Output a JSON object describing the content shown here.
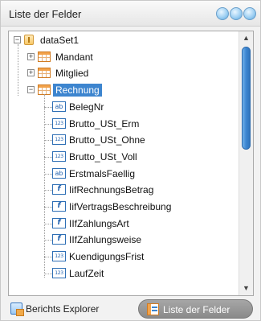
{
  "window": {
    "title": "Liste der Felder"
  },
  "tree": {
    "root": {
      "label": "dataSet1",
      "icon": "database-icon",
      "expander": "−"
    },
    "tables": [
      {
        "label": "Mandant",
        "icon": "table-icon",
        "expander": "+"
      },
      {
        "label": "Mitglied",
        "icon": "table-icon",
        "expander": "+"
      },
      {
        "label": "Rechnung",
        "icon": "table-icon",
        "expander": "−",
        "selected": true
      }
    ],
    "fields": [
      {
        "label": "BelegNr",
        "type": "ab"
      },
      {
        "label": "Brutto_USt_Erm",
        "type": "123"
      },
      {
        "label": "Brutto_USt_Ohne",
        "type": "123"
      },
      {
        "label": "Brutto_USt_Voll",
        "type": "123"
      },
      {
        "label": "ErstmalsFaellig",
        "type": "ab"
      },
      {
        "label": "IifRechnungsBetrag",
        "type": "f"
      },
      {
        "label": "IifVertragsBeschreibung",
        "type": "f"
      },
      {
        "label": "IIfZahlungsArt",
        "type": "f"
      },
      {
        "label": "IIfZahlungsweise",
        "type": "f"
      },
      {
        "label": "KuendigungsFrist",
        "type": "123"
      },
      {
        "label": "LaufZeit",
        "type": "123"
      }
    ]
  },
  "scroll": {
    "up_arrow": "▲",
    "down_arrow": "▼"
  },
  "tabs": [
    {
      "label": "Berichts Explorer",
      "icon": "report-explorer-icon",
      "active": false
    },
    {
      "label": "Liste der Felder",
      "icon": "field-list-icon",
      "active": true
    }
  ],
  "colors": {
    "selection": "#3d85cf",
    "scroll_thumb": "#3b86d1",
    "table_icon": "#f2a24a"
  }
}
